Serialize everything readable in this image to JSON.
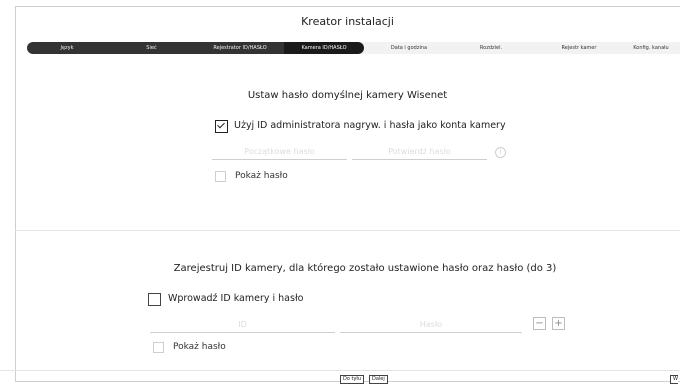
{
  "window": {
    "title": "Kreator instalacji"
  },
  "steps": [
    {
      "label": "Język",
      "state": "done"
    },
    {
      "label": "Sieć",
      "state": "done"
    },
    {
      "label": "Rejestrator ID/HASŁO",
      "state": "done"
    },
    {
      "label": "Kamera ID/HASŁO",
      "state": "active"
    },
    {
      "label": "Data i godzina",
      "state": "todo"
    },
    {
      "label": "Rozdziel.",
      "state": "todo"
    },
    {
      "label": "Rejestr kamer",
      "state": "todo"
    },
    {
      "label": "Konfig. kanału",
      "state": "todo"
    }
  ],
  "section1": {
    "heading": "Ustaw hasło domyślnej kamery Wisenet",
    "use_admin_label": "Użyj ID administratora nagryw. i hasła jako konta kamery",
    "use_admin_checked": true,
    "password_placeholder": "Początkowe hasło",
    "confirm_placeholder": "Potwierdź hasło",
    "info_glyph": "i",
    "show_password_label": "Pokaż hasło",
    "show_password_checked": false
  },
  "section2": {
    "heading": "Zarejestruj ID kamery, dla którego zostało ustawione hasło oraz hasło (do 3)",
    "enter_label": "Wprowadź ID kamery i hasło",
    "enter_checked": false,
    "id_placeholder": "ID",
    "pass_placeholder": "Hasło",
    "minus_glyph": "−",
    "plus_glyph": "+",
    "show_password_label": "Pokaż hasło",
    "show_password_checked": false
  },
  "footer": {
    "back_label": "Do tyłu",
    "next_label": "Dalej",
    "partial_label": "W"
  },
  "colors": {
    "active_step": "#1a1a1a",
    "done_step": "#333333",
    "inactive_track": "#f2f2f2"
  }
}
